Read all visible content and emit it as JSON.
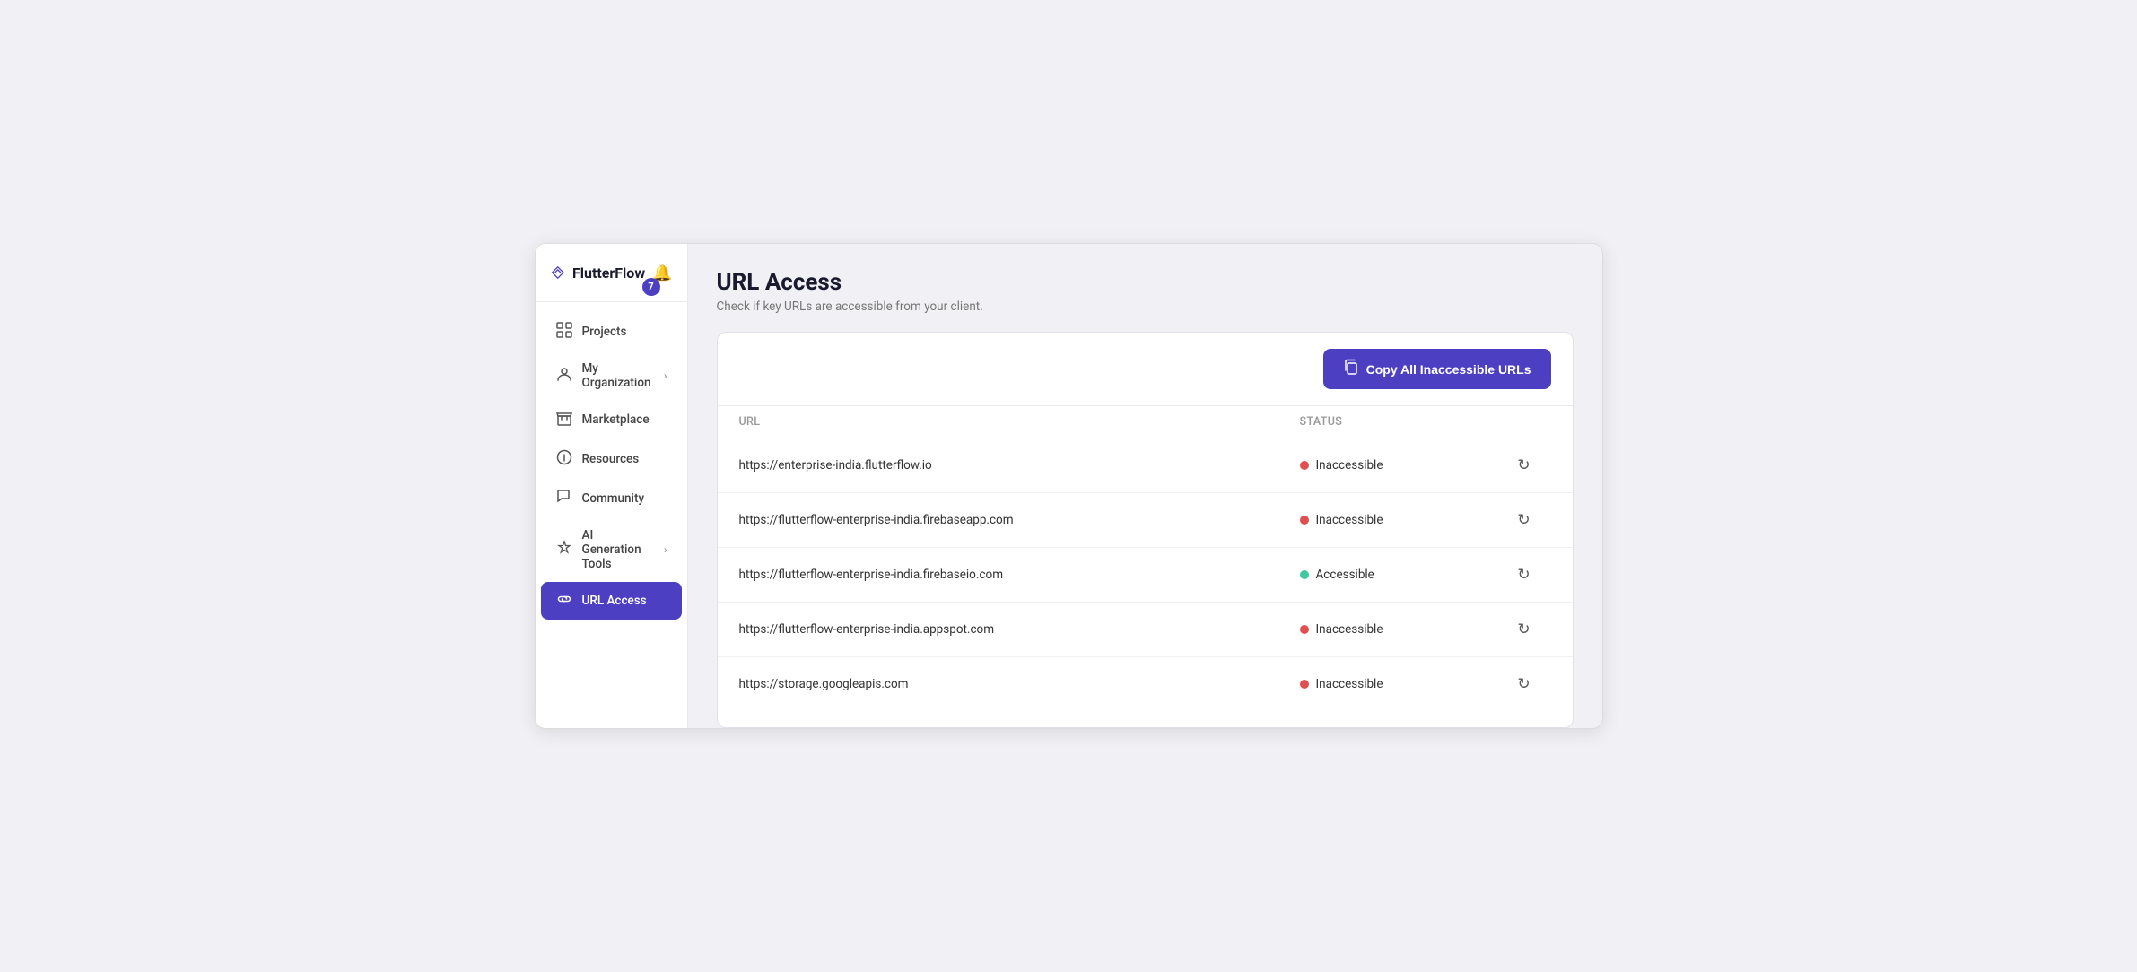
{
  "app": {
    "name": "FlutterFlow",
    "notification_count": "7"
  },
  "sidebar": {
    "items": [
      {
        "id": "projects",
        "label": "Projects",
        "icon": "⊞",
        "has_chevron": false
      },
      {
        "id": "my-organization",
        "label": "My Organization",
        "icon": "👤",
        "has_chevron": true
      },
      {
        "id": "marketplace",
        "label": "Marketplace",
        "icon": "🏪",
        "has_chevron": false
      },
      {
        "id": "resources",
        "label": "Resources",
        "icon": "❓",
        "has_chevron": false
      },
      {
        "id": "community",
        "label": "Community",
        "icon": "💬",
        "has_chevron": false
      },
      {
        "id": "ai-generation-tools",
        "label": "AI Generation Tools",
        "icon": "✦",
        "has_chevron": true
      }
    ],
    "active_item": {
      "id": "url-access",
      "label": "URL Access",
      "icon": "🔗"
    }
  },
  "page": {
    "title": "URL Access",
    "subtitle": "Check if key URLs are accessible from your client."
  },
  "toolbar": {
    "copy_button_label": "Copy All Inaccessible URLs"
  },
  "table": {
    "columns": {
      "url": "URL",
      "status": "Status"
    },
    "rows": [
      {
        "url": "https://enterprise-india.flutterflow.io",
        "status": "Inaccessible",
        "status_type": "inaccessible"
      },
      {
        "url": "https://flutterflow-enterprise-india.firebaseapp.com",
        "status": "Inaccessible",
        "status_type": "inaccessible"
      },
      {
        "url": "https://flutterflow-enterprise-india.firebaseio.com",
        "status": "Accessible",
        "status_type": "accessible"
      },
      {
        "url": "https://flutterflow-enterprise-india.appspot.com",
        "status": "Inaccessible",
        "status_type": "inaccessible"
      },
      {
        "url": "https://storage.googleapis.com",
        "status": "Inaccessible",
        "status_type": "inaccessible"
      }
    ]
  },
  "colors": {
    "brand": "#4c3fc1",
    "inaccessible": "#e05050",
    "accessible": "#40c9a0"
  }
}
